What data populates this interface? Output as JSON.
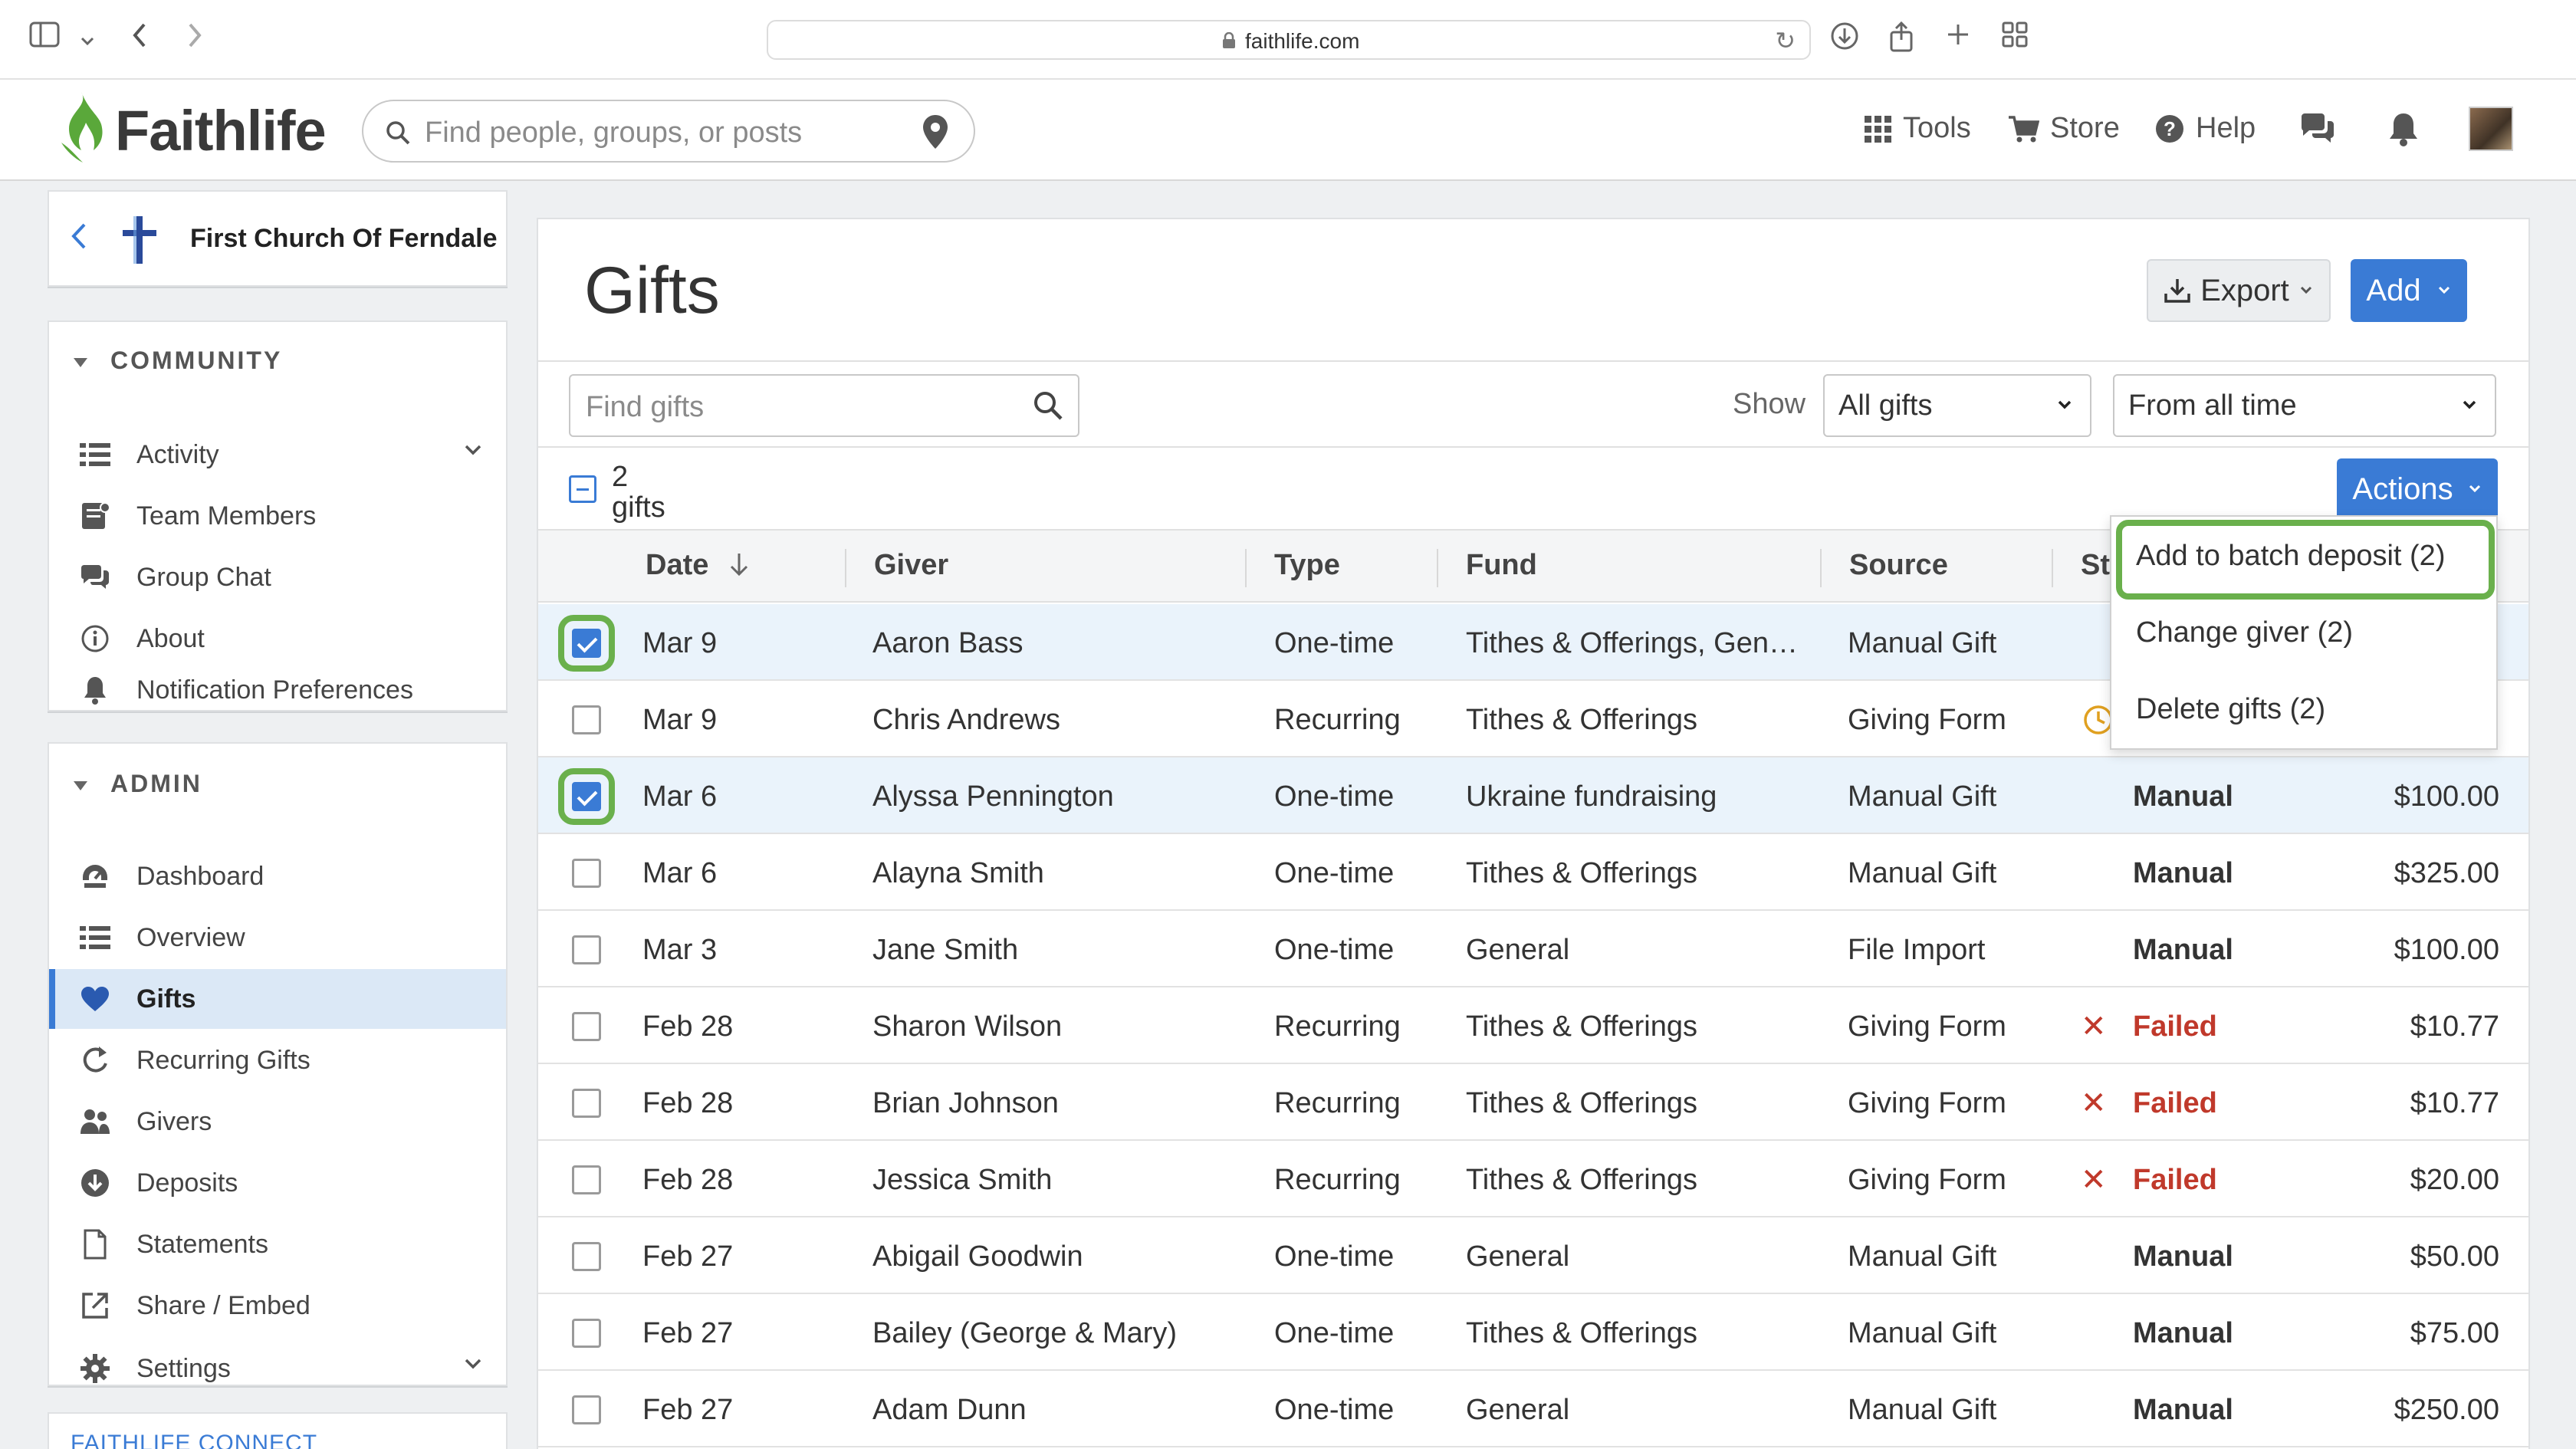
{
  "browser": {
    "url": "faithlife.com"
  },
  "header": {
    "brand": "Faithlife",
    "search_placeholder": "Find people, groups, or posts",
    "nav": {
      "tools": "Tools",
      "store": "Store",
      "help": "Help"
    }
  },
  "sidebar": {
    "church_name": "First Church Of Ferndale",
    "community_header": "COMMUNITY",
    "community_items": [
      {
        "label": "Activity",
        "icon": "activity-list-icon"
      },
      {
        "label": "Team Members",
        "icon": "team-members-icon"
      },
      {
        "label": "Group Chat",
        "icon": "chat-bubble-icon"
      },
      {
        "label": "About",
        "icon": "info-icon"
      },
      {
        "label": "Notification Preferences",
        "icon": "bell-icon"
      }
    ],
    "admin_header": "ADMIN",
    "admin_items": [
      {
        "label": "Dashboard",
        "icon": "dashboard-icon"
      },
      {
        "label": "Overview",
        "icon": "overview-list-icon"
      },
      {
        "label": "Gifts",
        "icon": "heart-icon"
      },
      {
        "label": "Recurring Gifts",
        "icon": "recurring-icon"
      },
      {
        "label": "Givers",
        "icon": "givers-icon"
      },
      {
        "label": "Deposits",
        "icon": "deposit-icon"
      },
      {
        "label": "Statements",
        "icon": "document-icon"
      },
      {
        "label": "Share / Embed",
        "icon": "share-icon"
      },
      {
        "label": "Settings",
        "icon": "gear-icon"
      }
    ],
    "footer_section": "FAITHLIFE CONNECT"
  },
  "main": {
    "title": "Gifts",
    "export_label": "Export",
    "add_label": "Add",
    "find_placeholder": "Find gifts",
    "show_label": "Show",
    "show_filter": "All gifts",
    "time_filter": "From all time",
    "selected_count": "2",
    "selected_unit": "gifts",
    "actions_label": "Actions",
    "columns": {
      "date": "Date",
      "giver": "Giver",
      "type": "Type",
      "fund": "Fund",
      "source": "Source",
      "status": "St"
    },
    "rows": [
      {
        "date": "Mar 9",
        "giver": "Aaron Bass",
        "type": "One-time",
        "fund": "Tithes & Offerings, Gen…",
        "source": "Manual Gift",
        "status": "",
        "amount": "",
        "checked": true
      },
      {
        "date": "Mar 9",
        "giver": "Chris Andrews",
        "type": "Recurring",
        "fund": "Tithes & Offerings",
        "source": "Giving Form",
        "status": "",
        "amount": "",
        "checked": false
      },
      {
        "date": "Mar 6",
        "giver": "Alyssa Pennington",
        "type": "One-time",
        "fund": "Ukraine fundraising",
        "source": "Manual Gift",
        "status": "Manual",
        "amount": "$100.00",
        "checked": true
      },
      {
        "date": "Mar 6",
        "giver": "Alayna Smith",
        "type": "One-time",
        "fund": "Tithes & Offerings",
        "source": "Manual Gift",
        "status": "Manual",
        "amount": "$325.00",
        "checked": false
      },
      {
        "date": "Mar 3",
        "giver": "Jane Smith",
        "type": "One-time",
        "fund": "General",
        "source": "File Import",
        "status": "Manual",
        "amount": "$100.00",
        "checked": false
      },
      {
        "date": "Feb 28",
        "giver": "Sharon Wilson",
        "type": "Recurring",
        "fund": "Tithes & Offerings",
        "source": "Giving Form",
        "status": "Failed",
        "amount": "$10.77",
        "checked": false
      },
      {
        "date": "Feb 28",
        "giver": "Brian Johnson",
        "type": "Recurring",
        "fund": "Tithes & Offerings",
        "source": "Giving Form",
        "status": "Failed",
        "amount": "$10.77",
        "checked": false
      },
      {
        "date": "Feb 28",
        "giver": "Jessica Smith",
        "type": "Recurring",
        "fund": "Tithes & Offerings",
        "source": "Giving Form",
        "status": "Failed",
        "amount": "$20.00",
        "checked": false
      },
      {
        "date": "Feb 27",
        "giver": "Abigail Goodwin",
        "type": "One-time",
        "fund": "General",
        "source": "Manual Gift",
        "status": "Manual",
        "amount": "$50.00",
        "checked": false
      },
      {
        "date": "Feb 27",
        "giver": "Bailey (George & Mary)",
        "type": "One-time",
        "fund": "Tithes & Offerings",
        "source": "Manual Gift",
        "status": "Manual",
        "amount": "$75.00",
        "checked": false
      },
      {
        "date": "Feb 27",
        "giver": "Adam Dunn",
        "type": "One-time",
        "fund": "General",
        "source": "Manual Gift",
        "status": "Manual",
        "amount": "$250.00",
        "checked": false
      }
    ],
    "actions_menu": [
      "Add to batch deposit (2)",
      "Change giver (2)",
      "Delete gifts (2)"
    ]
  },
  "colors": {
    "accent": "#3a7bd5",
    "highlight": "#6ab04c",
    "failed": "#c0392b",
    "brand_green": "#5aa83a"
  }
}
